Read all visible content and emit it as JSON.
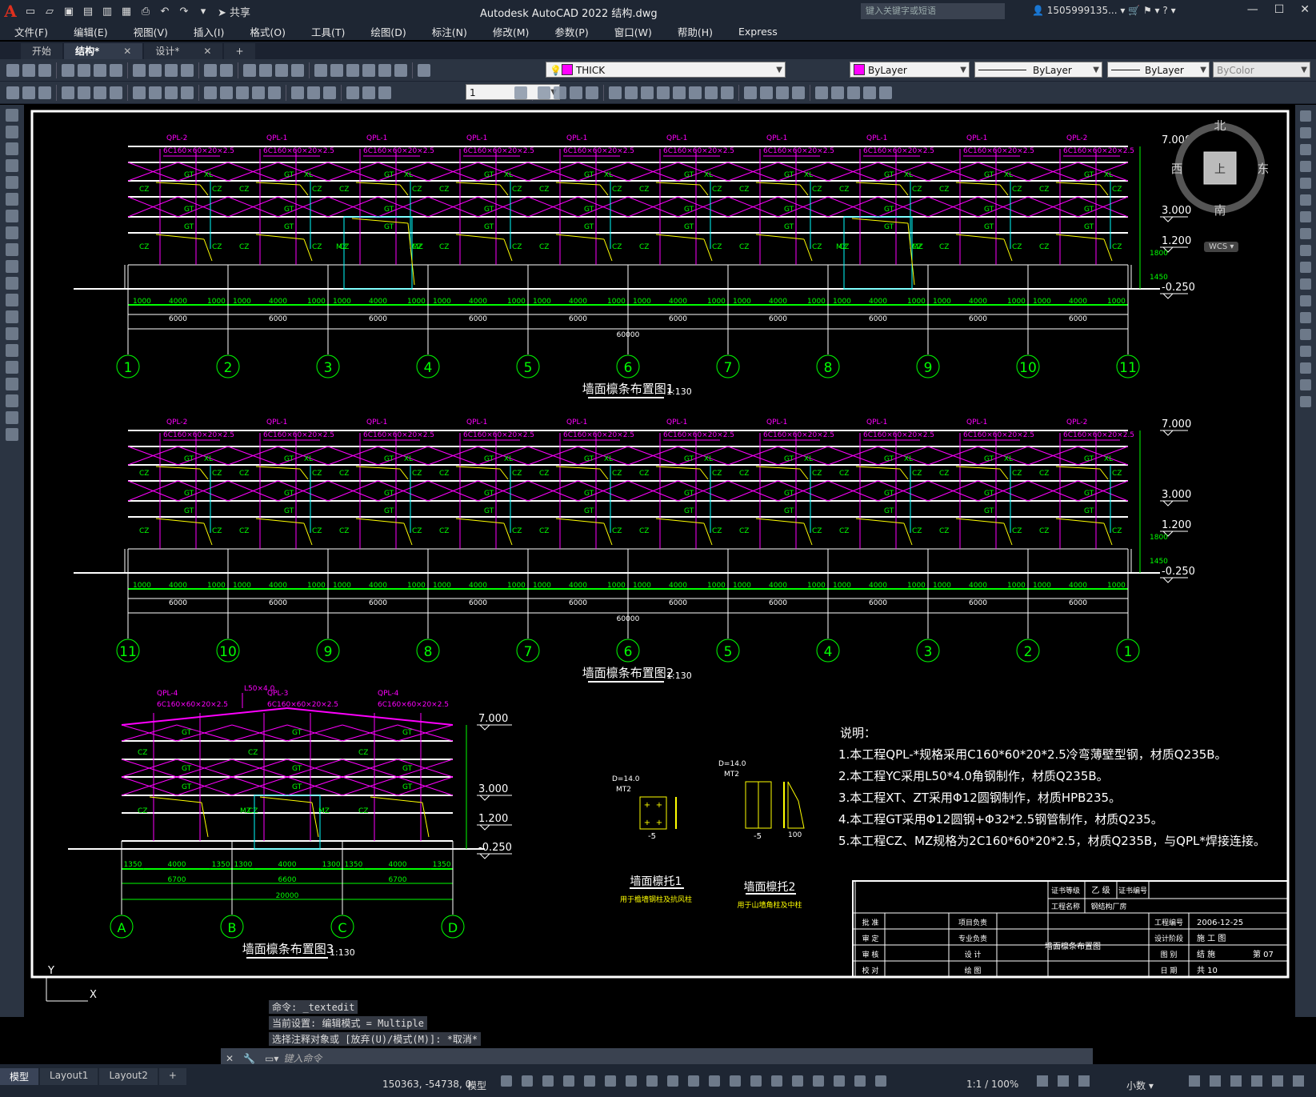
{
  "title_bar": {
    "app_logo": "A",
    "share_label": "共享",
    "window_title": "Autodesk AutoCAD 2022    结构.dwg",
    "search_placeholder": "键入关键字或短语",
    "user": "1505999135..."
  },
  "menu": [
    "文件(F)",
    "编辑(E)",
    "视图(V)",
    "插入(I)",
    "格式(O)",
    "工具(T)",
    "绘图(D)",
    "标注(N)",
    "修改(M)",
    "参数(P)",
    "窗口(W)",
    "帮助(H)",
    "Express"
  ],
  "tabs": [
    {
      "label": "开始",
      "closable": false,
      "active": false
    },
    {
      "label": "结构*",
      "closable": true,
      "active": true
    },
    {
      "label": "设计*",
      "closable": true,
      "active": false
    }
  ],
  "toolbar": {
    "layer": "THICK",
    "color": "ByLayer",
    "linetype": "ByLayer",
    "lineweight": "ByLayer",
    "plotstyle": "ByColor",
    "dim_value": "1"
  },
  "viewcube": {
    "north": "北",
    "south": "南",
    "east": "东",
    "west": "西",
    "top": "上",
    "wcs": "WCS"
  },
  "drawing": {
    "colors": {
      "magenta": "#ff00ff",
      "green": "#00ff00",
      "yellow": "#ffff00",
      "cyan": "#00ffff",
      "white": "#ffffff"
    },
    "elev1": {
      "title": "墙面檩条布置图1",
      "scale": "1:130",
      "qpl_labels": [
        "QPL-2",
        "QPL-1",
        "QPL-1",
        "QPL-1",
        "QPL-1",
        "QPL-1",
        "QPL-1",
        "QPL-1",
        "QPL-1",
        "QPL-2"
      ],
      "spec": "6C160×60×20×2.5",
      "axis_labels": [
        "1",
        "2",
        "3",
        "4",
        "5",
        "6",
        "7",
        "8",
        "9",
        "10",
        "11"
      ],
      "total_dim": "60000",
      "bay_dim": "6000",
      "sub_dims": [
        "1000",
        "4000",
        "1000"
      ],
      "elevations": [
        "7.000",
        "3.000",
        "1.200",
        "-0.250"
      ],
      "side_dims": [
        "1800",
        "1450"
      ],
      "member_labels": {
        "xl": "XL",
        "gt": "GT",
        "cz": "CZ",
        "mz": "MZ"
      }
    },
    "elev2": {
      "title": "墙面檩条布置图2",
      "scale": "1:130",
      "axis_labels": [
        "11",
        "10",
        "9",
        "8",
        "7",
        "6",
        "5",
        "4",
        "3",
        "2",
        "1"
      ],
      "total_dim": "60000",
      "elevations": [
        "7.000",
        "3.000",
        "1.200",
        "-0.250"
      ]
    },
    "elev3": {
      "title": "墙面檩条布置图3",
      "scale": "1:130",
      "qpl_labels": [
        "QPL-4",
        "QPL-3",
        "QPL-4"
      ],
      "angle_label": "L50×4.0",
      "axis_labels": [
        "A",
        "B",
        "C",
        "D"
      ],
      "top_dims": [
        "1350",
        "4000",
        "1350",
        "1300",
        "4000",
        "1300",
        "1350",
        "4000",
        "1350"
      ],
      "bay_dims": [
        "6700",
        "6600",
        "6700"
      ],
      "total_dim": "20000",
      "elevations": [
        "7.000",
        "3.000",
        "1.200",
        "-0.250"
      ]
    },
    "details": [
      {
        "title": "墙面檩托1",
        "note": "用于檐墙钢柱及抗风柱",
        "d": "D=14.0",
        "mt": "MT2",
        "plate": "-5"
      },
      {
        "title": "墙面檩托2",
        "note": "用于山墙角柱及中柱",
        "d": "D=14.0",
        "mt": "MT2",
        "plate": "-5",
        "extra": "100"
      }
    ],
    "notes": {
      "heading": "说明：",
      "lines": [
        "1.本工程QPL-*规格采用C160*60*20*2.5冷弯薄壁型钢，材质Q235B。",
        "2.本工程YC采用L50*4.0角钢制作，材质Q235B。",
        "3.本工程XT、ZT采用Φ12圆钢制作，材质HPB235。",
        "4.本工程GT采用Φ12圆钢+Φ32*2.5钢管制作，材质Q235。",
        "5.本工程CZ、MZ规格为2C160*60*20*2.5，材质Q235B，与QPL*焊接连接。"
      ]
    },
    "title_block": {
      "cert_grade_label": "证书等级",
      "cert_grade": "乙 级",
      "cert_no_label": "证书编号",
      "project_name_label": "工程名称",
      "project_name": "钢结构厂房",
      "rows_left": [
        "批 准",
        "审 定",
        "审 核",
        "校 对"
      ],
      "rows_mid": [
        "项目负责",
        "专业负责",
        "设 计",
        "绘 图"
      ],
      "drawing_name": "墙面檩条布置图",
      "right_labels": [
        "工程编号",
        "设计阶段",
        "图 别",
        "日 期"
      ],
      "right_values": [
        "2006-12-25",
        "施 工 图",
        "结 施",
        "共 10"
      ],
      "sheet": "第 07"
    }
  },
  "command_history": [
    "命令: _textedit",
    "当前设置: 编辑模式 = Multiple",
    "选择注释对象或 [放弃(U)/模式(M)]: *取消*"
  ],
  "command_placeholder": "键入命令",
  "layout_tabs": [
    {
      "label": "模型",
      "active": true
    },
    {
      "label": "Layout1",
      "active": false
    },
    {
      "label": "Layout2",
      "active": false
    }
  ],
  "status": {
    "coords": "150363, -54738, 0",
    "model": "模型",
    "scale": "1:1 / 100%",
    "units": "小数"
  }
}
